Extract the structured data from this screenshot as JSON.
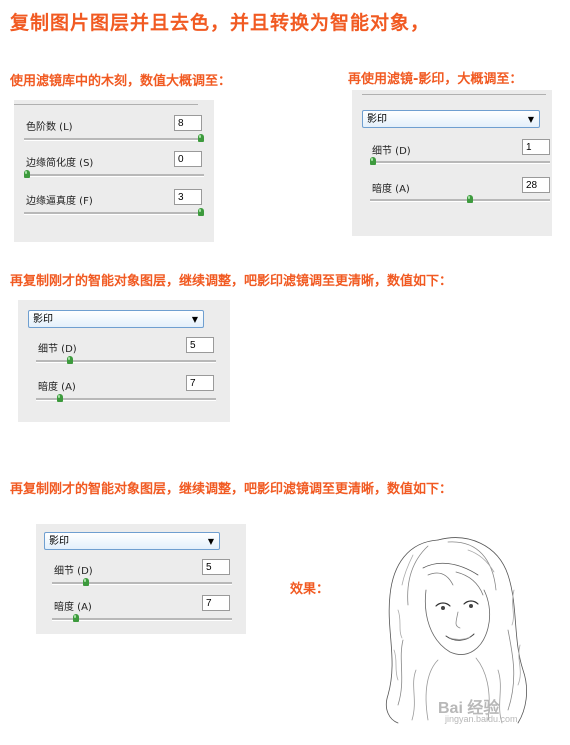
{
  "title": "复制图片图层并且去色，并且转换为智能对象，",
  "step1": {
    "heading": "使用滤镜库中的木刻，数值大概调至：",
    "params": [
      {
        "label": "色阶数 (L)",
        "value": "8",
        "fraction": 1.0
      },
      {
        "label": "边缘简化度 (S)",
        "value": "0",
        "fraction": 0.0
      },
      {
        "label": "边缘逼真度 (F)",
        "value": "3",
        "fraction": 1.0
      }
    ]
  },
  "step2": {
    "heading": "再使用滤镜-影印，大概调至：",
    "filter": "影印",
    "params": [
      {
        "label": "细节 (D)",
        "value": "1",
        "fraction": 0.0
      },
      {
        "label": "暗度 (A)",
        "value": "28",
        "fraction": 0.56
      }
    ]
  },
  "step3": {
    "heading": "再复制刚才的智能对象图层，继续调整，吧影印滤镜调至更清晰，数值如下：",
    "filter": "影印",
    "params": [
      {
        "label": "细节 (D)",
        "value": "5",
        "fraction": 0.18
      },
      {
        "label": "暗度 (A)",
        "value": "7",
        "fraction": 0.12
      }
    ]
  },
  "step4": {
    "heading": "再复制刚才的智能对象图层，继续调整，吧影印滤镜调至更清晰，数值如下：",
    "filter": "影印",
    "params": [
      {
        "label": "细节 (D)",
        "value": "5",
        "fraction": 0.18
      },
      {
        "label": "暗度 (A)",
        "value": "7",
        "fraction": 0.12
      }
    ],
    "effect_label": "效果：",
    "watermark": "Bai 经验",
    "watermark_sub": "jingyan.baidu.com"
  }
}
